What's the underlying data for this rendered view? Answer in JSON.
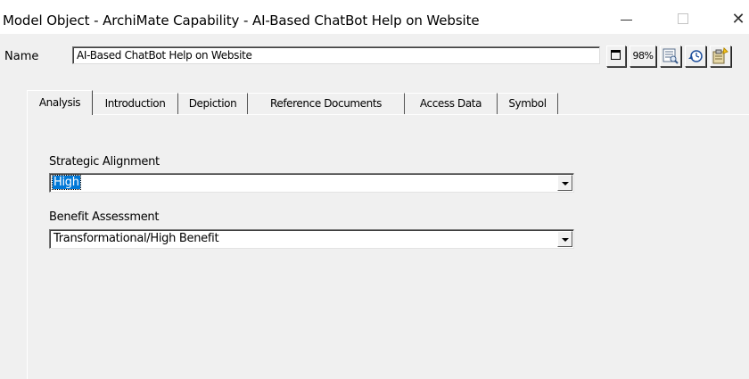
{
  "window": {
    "title": "Model Object - ArchiMate Capability - AI-Based ChatBot Help on Website",
    "minimize_icon": "minimize-icon",
    "maximize_icon": "maximize-icon",
    "close_icon": "close-icon",
    "close_glyph": "✕"
  },
  "name_row": {
    "label": "Name",
    "value": "AI-Based ChatBot Help on Website",
    "zoom_label": "98%"
  },
  "tabs": [
    {
      "label": "Analysis",
      "active": true
    },
    {
      "label": "Introduction"
    },
    {
      "label": "Depiction"
    },
    {
      "label": "Reference Documents"
    },
    {
      "label": "Access Data"
    },
    {
      "label": "Symbol"
    }
  ],
  "analysis": {
    "strategic_alignment": {
      "label": "Strategic Alignment",
      "value": "High"
    },
    "benefit_assessment": {
      "label": "Benefit Assessment",
      "value": "Transformational/High Benefit"
    }
  }
}
